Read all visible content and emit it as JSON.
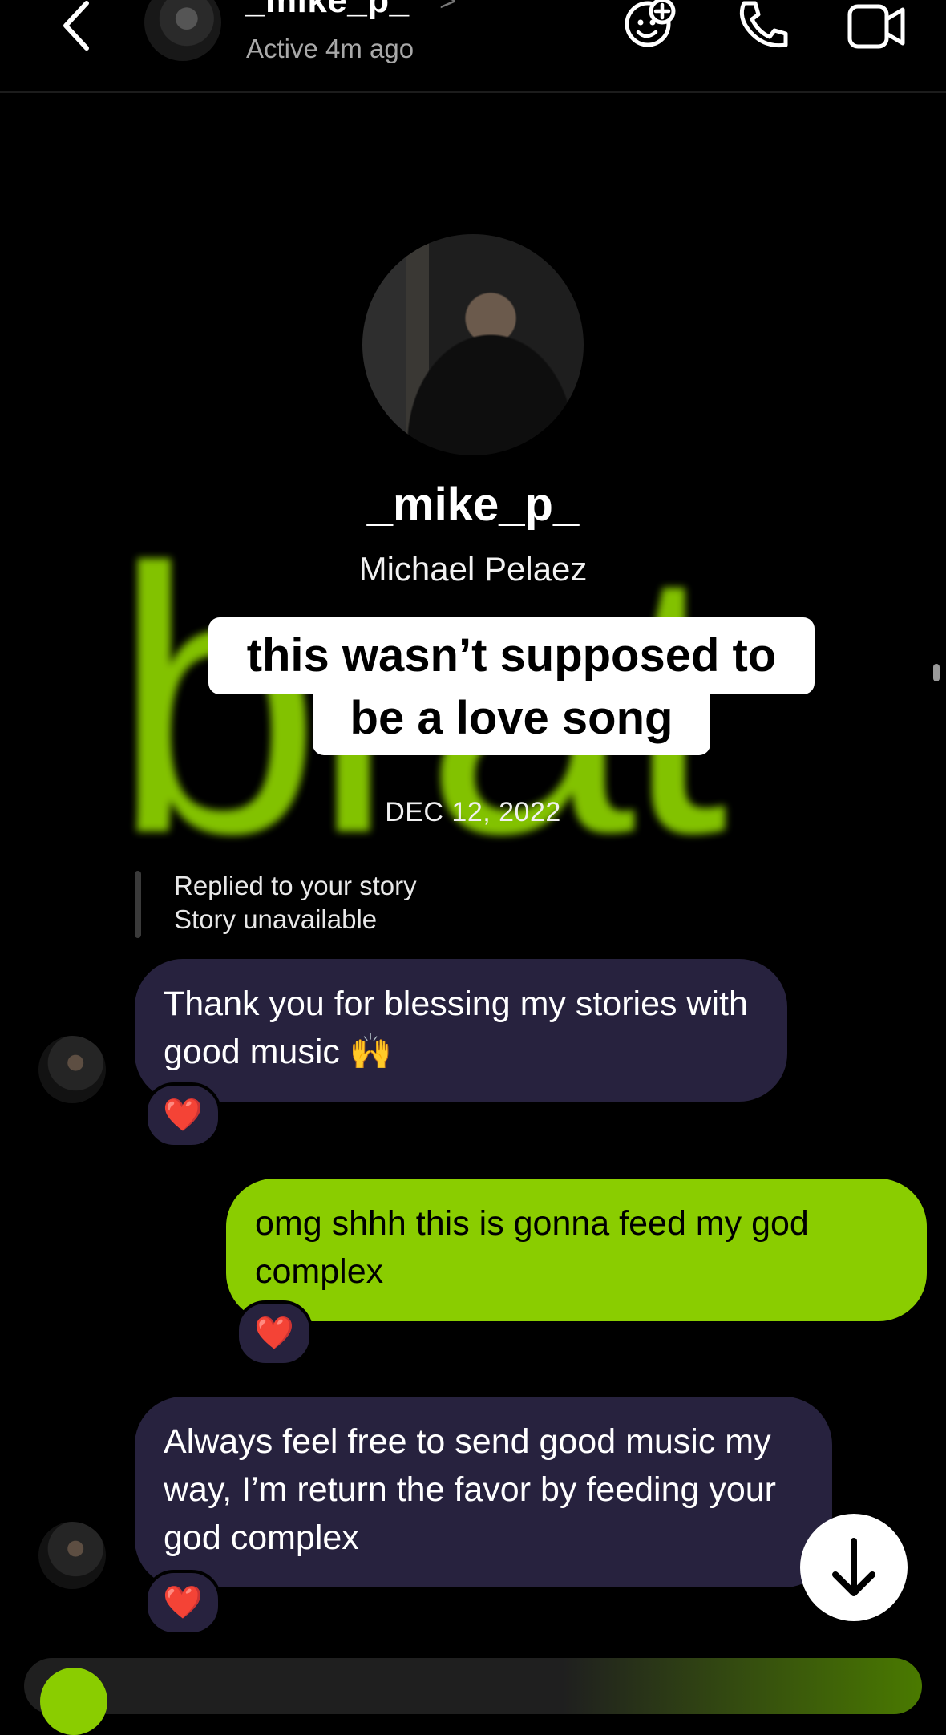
{
  "header": {
    "username": "_mike_p_",
    "chevron": ">",
    "status": "Active 4m ago"
  },
  "profile": {
    "username": "_mike_p_",
    "full_name": "Michael Pelaez"
  },
  "overlay": {
    "brat_text": "brat",
    "brat_color": "#8acd00",
    "caption_line1": "this wasn’t supposed to",
    "caption_line2": "be a love song"
  },
  "thread": {
    "date": "DEC 12, 2022",
    "reply_label": "Replied to your story",
    "reply_sub": "Story unavailable",
    "messages": [
      {
        "text": "Thank you for blessing my stories with good music 🙌",
        "from": "them",
        "reaction": "❤️"
      },
      {
        "text": "omg shhh this is gonna feed my god complex",
        "from": "me",
        "reaction": "❤️"
      },
      {
        "text": "Always feel free to send good music my way, I’m return the favor by feeding your god complex",
        "from": "them",
        "reaction": "❤️"
      }
    ]
  },
  "colors": {
    "incoming_bubble": "#27223e",
    "outgoing_bubble": "#8acd00",
    "background": "#000000"
  },
  "icons": {
    "back": "chevron-left-icon",
    "sticker": "sticker-add-icon",
    "call": "phone-icon",
    "video": "video-camera-icon",
    "scroll": "arrow-down-icon"
  }
}
